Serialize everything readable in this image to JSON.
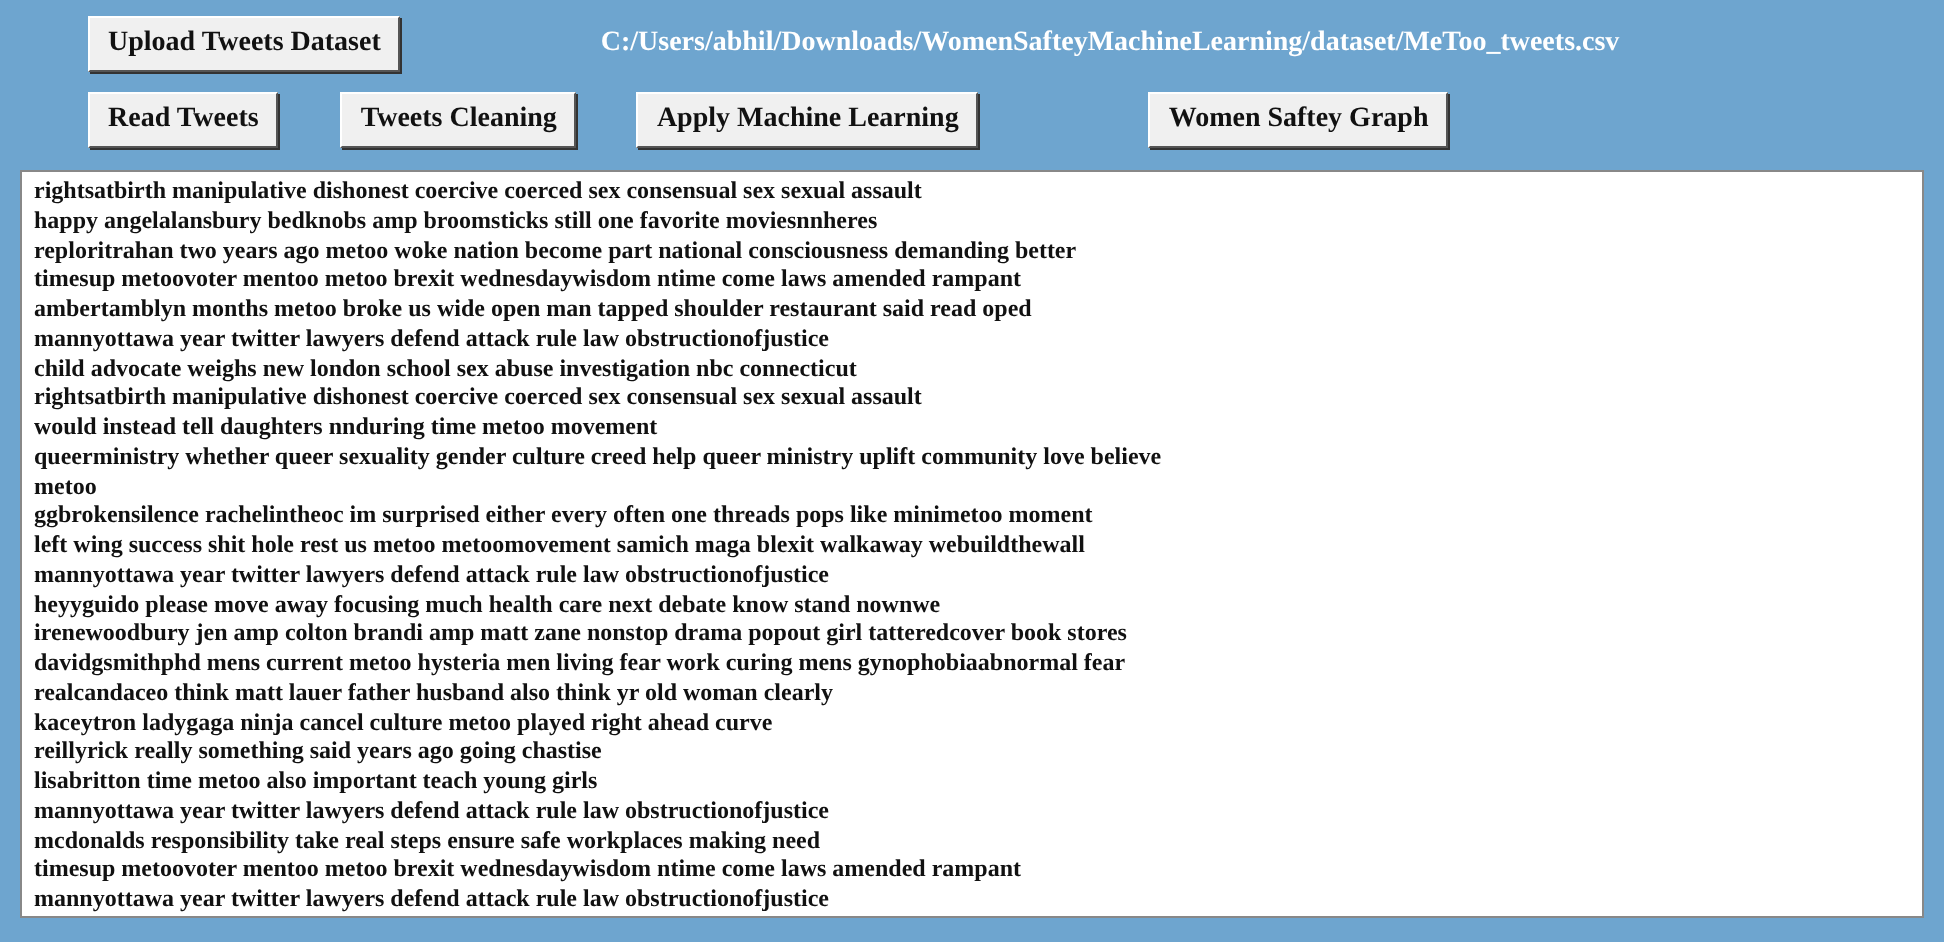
{
  "upload_button": "Upload Tweets Dataset",
  "file_path": "C:/Users/abhil/Downloads/WomenSafteyMachineLearning/dataset/MeToo_tweets.csv",
  "buttons": [
    "Read Tweets",
    "Tweets Cleaning",
    "Apply Machine Learning",
    "Women Saftey Graph"
  ],
  "output_lines": [
    "rightsatbirth manipulative dishonest coercive coerced sex consensual sex sexual assault",
    "happy angelalansbury bedknobs amp broomsticks still one favorite moviesnnheres",
    "reploritrahan two years ago metoo woke nation become part national consciousness demanding better",
    "timesup metoovoter mentoo metoo brexit wednesdaywisdom ntime come laws amended rampant",
    "ambertamblyn months metoo broke us wide open man tapped shoulder restaurant said read oped",
    "mannyottawa year twitter lawyers defend attack rule law obstructionofjustice",
    "child advocate weighs new london school sex abuse investigation nbc connecticut",
    "rightsatbirth manipulative dishonest coercive coerced sex consensual sex sexual assault",
    "would instead tell daughters nnduring time metoo movement",
    "queerministry whether queer sexuality gender culture creed help queer ministry uplift community love believe",
    "metoo",
    "ggbrokensilence rachelintheoc im surprised either every often one threads pops like minimetoo moment",
    "left wing success shit hole rest us metoo metoomovement samich maga blexit walkaway webuildthewall",
    "mannyottawa year twitter lawyers defend attack rule law obstructionofjustice",
    "heyyguido please move away focusing much health care next debate know stand nownwe",
    "irenewoodbury jen amp colton brandi amp matt zane nonstop drama popout girl tatteredcover book stores",
    "davidgsmithphd mens current metoo hysteria men living fear work curing mens gynophobiaabnormal fear",
    "realcandaceo think matt lauer father husband also think yr old woman clearly",
    "kaceytron ladygaga ninja cancel culture metoo played right ahead curve",
    "reillyrick really something said years ago going chastise",
    "lisabritton time metoo also important teach young girls",
    "mannyottawa year twitter lawyers defend attack rule law obstructionofjustice",
    "mcdonalds responsibility take real steps ensure safe workplaces making need",
    "timesup metoovoter mentoo metoo brexit wednesdaywisdom ntime come laws amended rampant",
    "mannyottawa year twitter lawyers defend attack rule law obstructionofjustice"
  ]
}
